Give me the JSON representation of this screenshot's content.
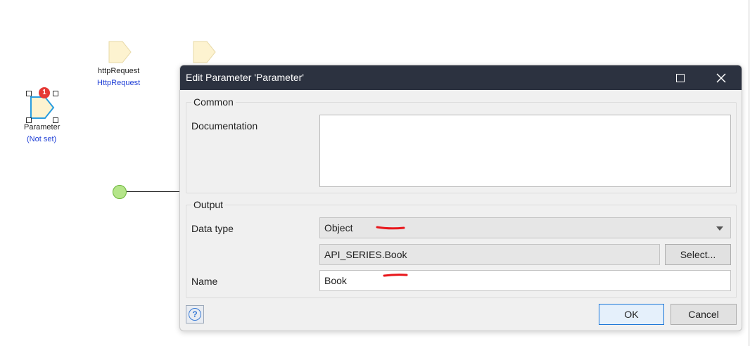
{
  "canvas": {
    "http_request_node": {
      "name": "httpRequest",
      "type": "HttpRequest"
    },
    "parameter_node": {
      "name": "Parameter",
      "type": "(Not set)",
      "badge_count": "1"
    }
  },
  "dialog": {
    "title": "Edit Parameter 'Parameter'",
    "common": {
      "group_label": "Common",
      "documentation_label": "Documentation",
      "documentation_value": ""
    },
    "output": {
      "group_label": "Output",
      "data_type_label": "Data type",
      "data_type_value": "Object",
      "entity_value": "API_SERIES.Book",
      "select_button": "Select...",
      "name_label": "Name",
      "name_value": "Book"
    },
    "footer": {
      "help_glyph": "?",
      "ok_button": "OK",
      "cancel_button": "Cancel"
    }
  },
  "colors": {
    "titlebar": "#2c3240",
    "annotation_ink": "#e8161b",
    "start_event_fill": "#b5e58a",
    "parameter_outline": "#2a9de0",
    "node_fill": "#fdf3d0"
  },
  "icons": [
    "parameter-shape-icon",
    "maximize-icon",
    "close-icon",
    "dropdown-arrow-icon",
    "help-icon"
  ]
}
